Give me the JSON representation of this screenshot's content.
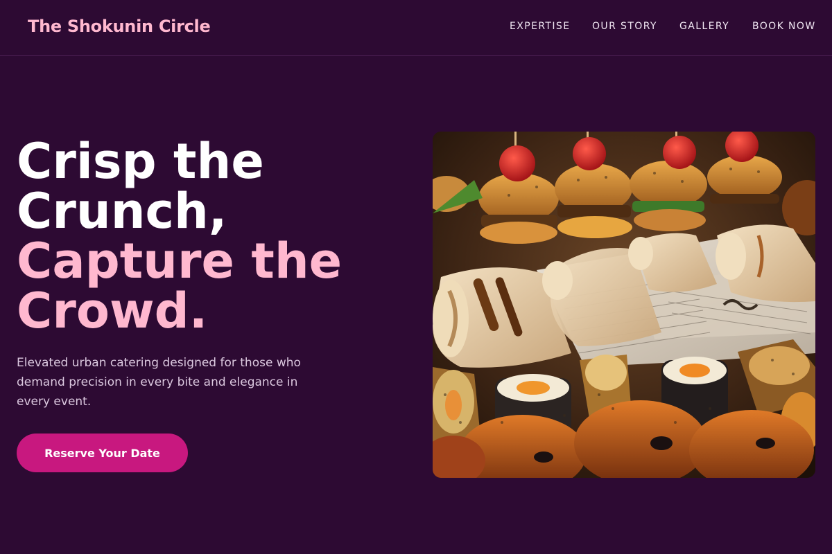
{
  "brand": {
    "name": "The Shokunin Circle"
  },
  "nav": {
    "items": [
      {
        "label": "EXPERTISE"
      },
      {
        "label": "OUR STORY"
      },
      {
        "label": "GALLERY"
      },
      {
        "label": "BOOK NOW"
      }
    ]
  },
  "hero": {
    "title_white": [
      "Crisp the",
      "Crunch,"
    ],
    "title_pink": [
      "Capture the",
      "Crowd."
    ],
    "description_lines": [
      "Elevated urban catering designed for those who",
      "demand precision in every bite and elegance in",
      "every event."
    ],
    "cta_label": "Reserve Your Date",
    "image_label": "catering-platter-photo"
  },
  "colors": {
    "background": "#2d0a33",
    "brand_pink": "#ffb8cf",
    "accent_magenta": "#c8187f",
    "nav_text": "#f0e6f2",
    "body_text": "#dbc8df"
  }
}
